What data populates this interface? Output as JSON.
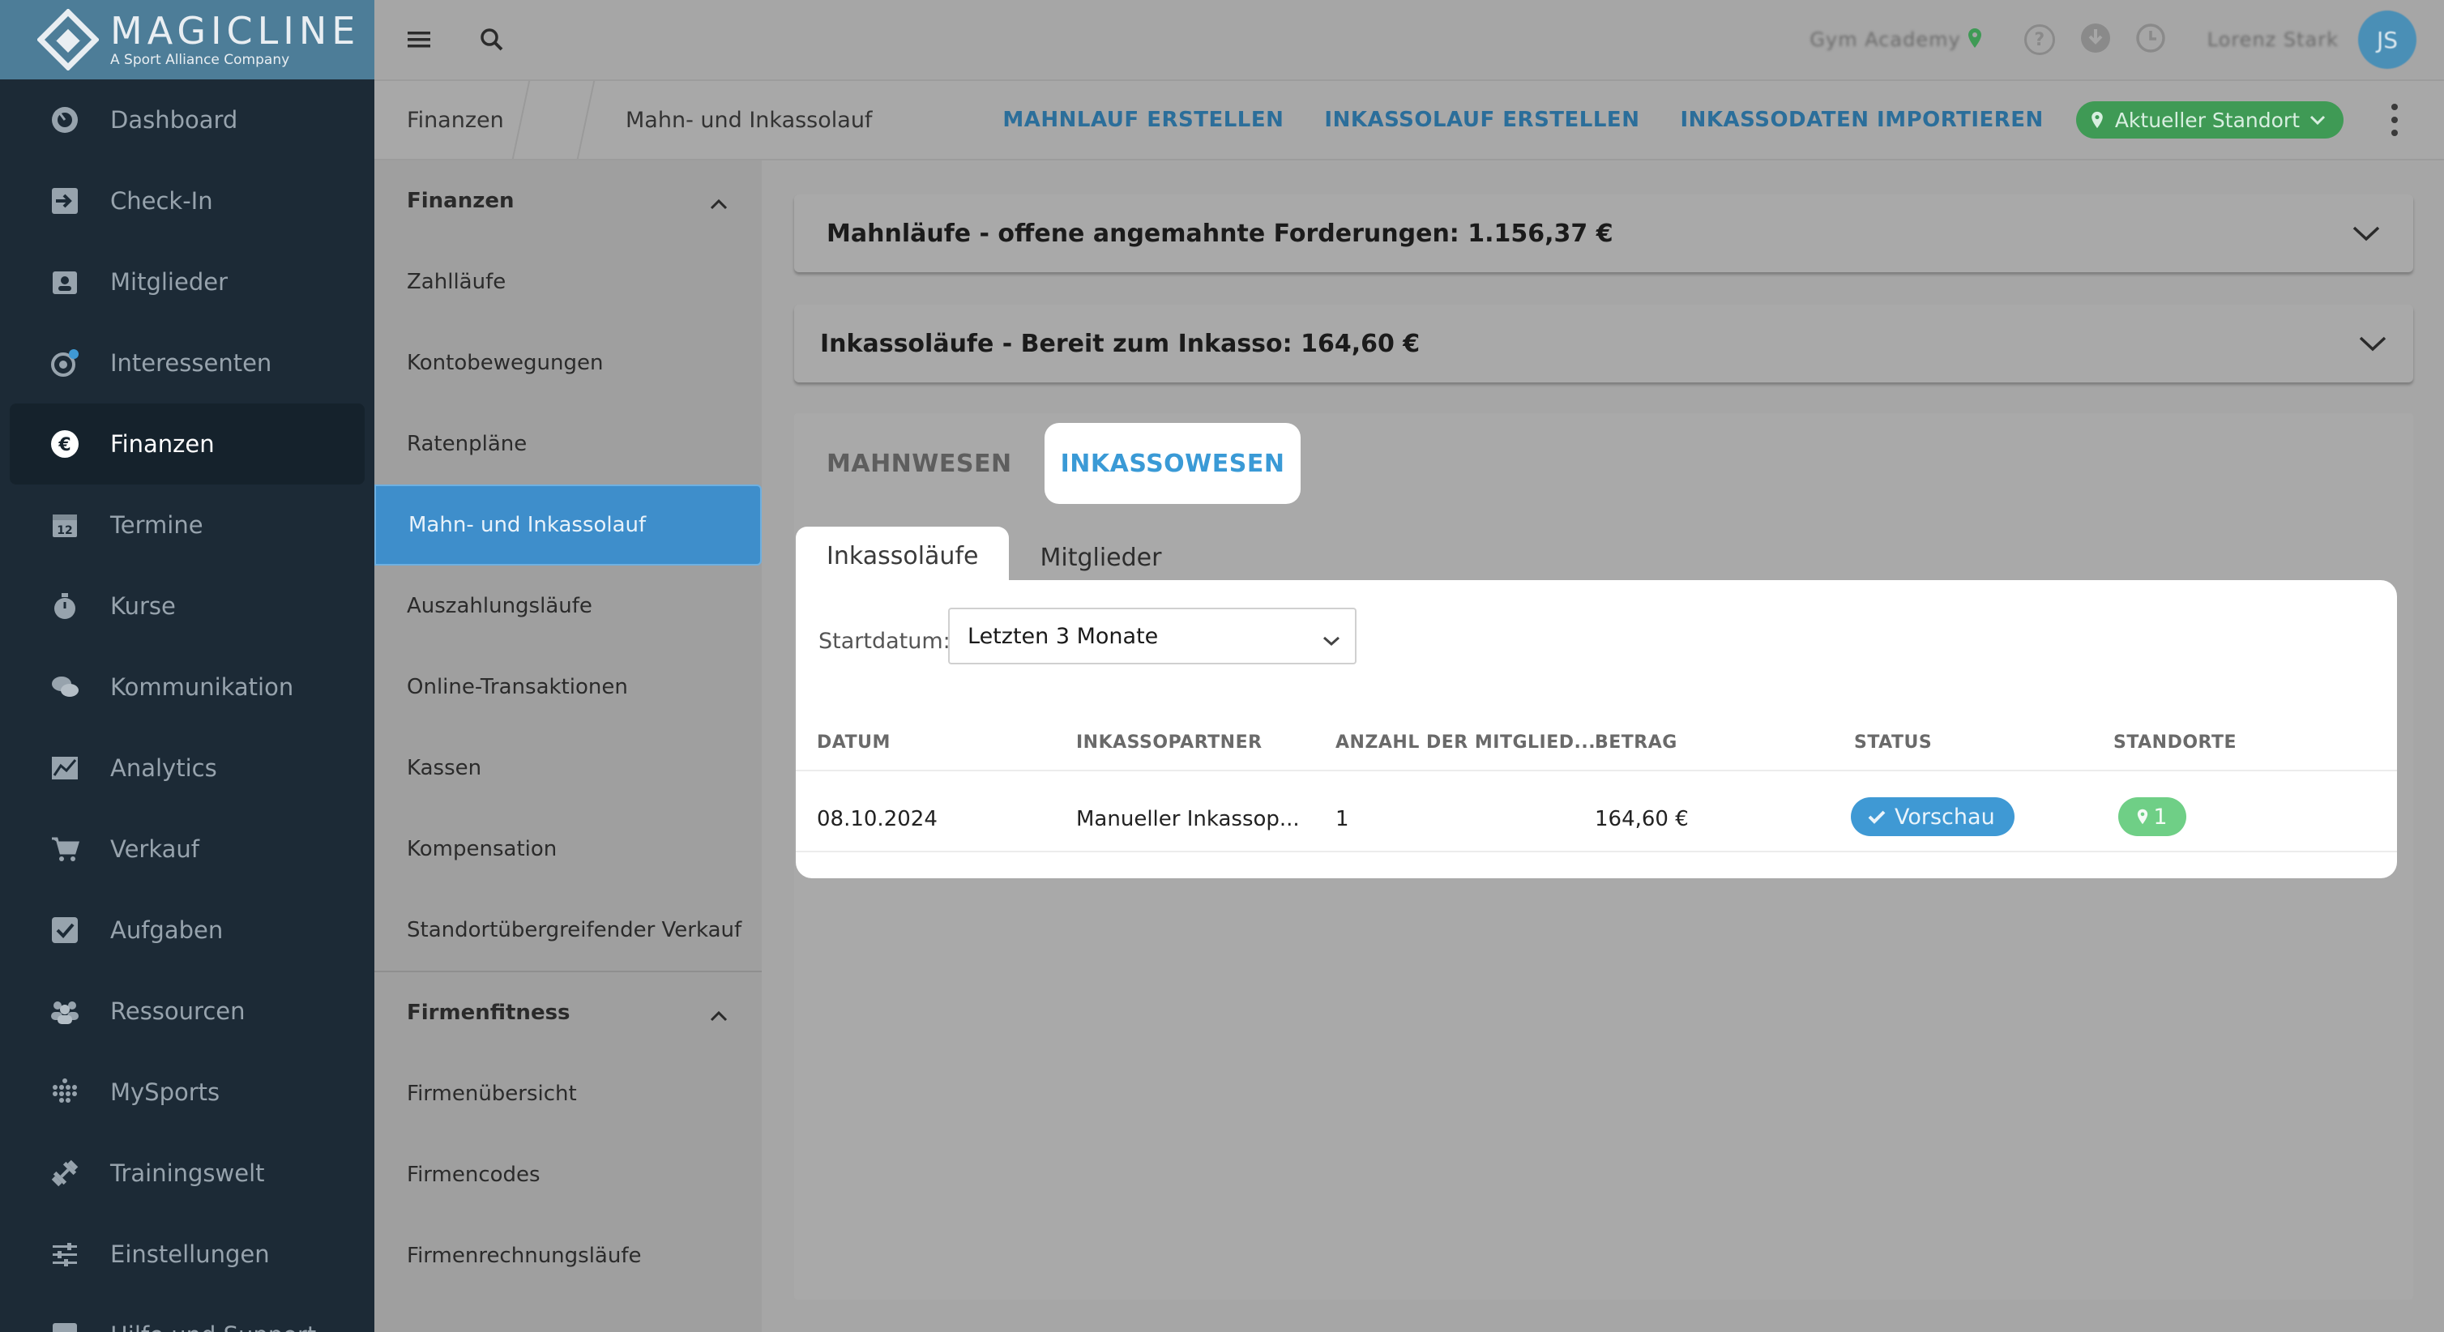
{
  "brand": {
    "name": "MAGICLINE",
    "tagline": "A Sport Alliance Company"
  },
  "nav": [
    {
      "label": "Dashboard",
      "icon": "dashboard-icon"
    },
    {
      "label": "Check-In",
      "icon": "checkin-icon"
    },
    {
      "label": "Mitglieder",
      "icon": "members-icon"
    },
    {
      "label": "Interessenten",
      "icon": "prospects-icon"
    },
    {
      "label": "Finanzen",
      "icon": "euro-icon",
      "active": true
    },
    {
      "label": "Termine",
      "icon": "calendar-icon"
    },
    {
      "label": "Kurse",
      "icon": "stopwatch-icon"
    },
    {
      "label": "Kommunikation",
      "icon": "chat-icon"
    },
    {
      "label": "Analytics",
      "icon": "chart-icon"
    },
    {
      "label": "Verkauf",
      "icon": "cart-icon"
    },
    {
      "label": "Aufgaben",
      "icon": "checkbox-icon"
    },
    {
      "label": "Ressourcen",
      "icon": "people-icon"
    },
    {
      "label": "MySports",
      "icon": "dots-grid-icon"
    },
    {
      "label": "Trainingswelt",
      "icon": "dumbbell-icon"
    },
    {
      "label": "Einstellungen",
      "icon": "sliders-icon"
    },
    {
      "label": "Hilfe und Support",
      "icon": "help-icon"
    }
  ],
  "topbar": {
    "studio_blurred": "Gym Academy",
    "user_blurred": "Lorenz Stark",
    "avatar_initials": "JS"
  },
  "breadcrumb": {
    "root": "Finanzen",
    "current": "Mahn- und Inkassolauf"
  },
  "actions": {
    "mahnlauf": "MAHNLAUF ERSTELLEN",
    "inkassolauf": "INKASSOLAUF ERSTELLEN",
    "import": "INKASSODATEN IMPORTIEREN",
    "location": "Aktueller Standort"
  },
  "submenu": {
    "section1": "Finanzen",
    "items1": [
      "Zahlläufe",
      "Kontobewegungen",
      "Ratenpläne",
      "Mahn- und Inkassolauf",
      "Auszahlungsläufe",
      "Online-Transaktionen",
      "Kassen",
      "Kompensation",
      "Standortübergreifender Verkauf"
    ],
    "section2": "Firmenfitness",
    "items2": [
      "Firmenübersicht",
      "Firmencodes",
      "Firmenrechnungsläufe"
    ]
  },
  "cards": {
    "mahn": "Mahnläufe - offene angemahnte Forderungen: 1.156,37 €",
    "inkasso": "Inkassoläufe - Bereit zum Inkasso: 164,60 €"
  },
  "tabs": {
    "mahnwesen": "MAHNWESEN",
    "inkassowesen": "INKASSOWESEN"
  },
  "subtabs": {
    "runs": "Inkassoläufe",
    "members": "Mitglieder"
  },
  "filter": {
    "label": "Startdatum:",
    "value": "Letzten 3 Monate"
  },
  "table": {
    "headers": [
      "DATUM",
      "INKASSOPARTNER",
      "ANZAHL DER MITGLIED...",
      "BETRAG",
      "STATUS",
      "STANDORTE"
    ],
    "row": {
      "date": "08.10.2024",
      "partner": "Manueller Inkassop...",
      "count": "1",
      "amount": "164,60 €",
      "status": "Vorschau",
      "locations": "1"
    }
  }
}
